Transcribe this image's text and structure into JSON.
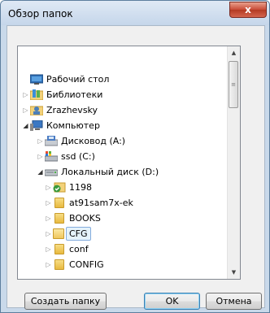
{
  "window": {
    "title": "Обзор папок",
    "close_glyph": "x"
  },
  "tree": {
    "items": [
      {
        "label": "Рабочий стол",
        "icon": "desktop-icon",
        "expander": ""
      },
      {
        "label": "Библиотеки",
        "icon": "libraries-icon",
        "expander": "▷"
      },
      {
        "label": "Zrazhevsky",
        "icon": "user-folder-icon",
        "expander": "▷"
      },
      {
        "label": "Компьютер",
        "icon": "computer-icon",
        "expander": "◢"
      },
      {
        "label": "Дисковод (A:)",
        "icon": "floppy-drive-icon",
        "expander": "▷"
      },
      {
        "label": "ssd (C:)",
        "icon": "system-drive-icon",
        "expander": "▷"
      },
      {
        "label": "Локальный диск (D:)",
        "icon": "hard-drive-icon",
        "expander": "◢"
      },
      {
        "label": "1198",
        "icon": "shared-folder-icon",
        "expander": "▷"
      },
      {
        "label": "at91sam7x-ek",
        "icon": "folder-icon",
        "expander": "▷"
      },
      {
        "label": "BOOKS",
        "icon": "folder-icon",
        "expander": "▷"
      },
      {
        "label": "CFG",
        "icon": "folder-open-icon",
        "expander": "▷",
        "selected": true
      },
      {
        "label": "conf",
        "icon": "folder-icon",
        "expander": "▷"
      },
      {
        "label": "CONFIG",
        "icon": "folder-icon",
        "expander": "▷"
      }
    ]
  },
  "scrollbar": {
    "up_glyph": "▲",
    "down_glyph": "▼",
    "grip_glyph": "≡"
  },
  "buttons": {
    "create_folder": "Создать папку",
    "ok": "OK",
    "cancel": "Отмена"
  }
}
